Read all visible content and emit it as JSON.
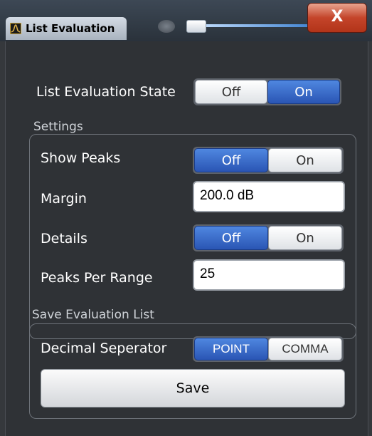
{
  "window": {
    "title": "List Evaluation",
    "close_label": "X"
  },
  "list_evaluation_state": {
    "label": "List Evaluation State",
    "options": [
      "Off",
      "On"
    ],
    "selected": "On"
  },
  "settings": {
    "title": "Settings",
    "show_peaks": {
      "label": "Show Peaks",
      "options": [
        "Off",
        "On"
      ],
      "selected": "Off"
    },
    "margin": {
      "label": "Margin",
      "value": "200.0 dB"
    },
    "details": {
      "label": "Details",
      "options": [
        "Off",
        "On"
      ],
      "selected": "Off"
    },
    "peaks_per_range": {
      "label": "Peaks Per Range",
      "value": "25"
    }
  },
  "save_evaluation_list": {
    "title": "Save Evaluation List",
    "decimal_separator": {
      "label": "Decimal Seperator",
      "options": [
        "POINT",
        "COMMA"
      ],
      "selected": "POINT"
    },
    "save_label": "Save"
  },
  "colors": {
    "selected_segment": "#3a6fd0",
    "background": "#2f3236",
    "close_button": "#c4442a"
  }
}
